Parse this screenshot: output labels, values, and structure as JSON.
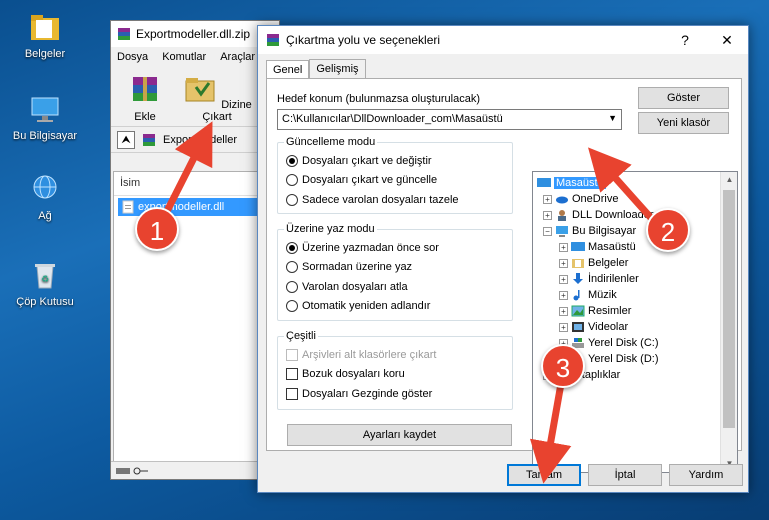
{
  "desktop": {
    "icons": [
      {
        "label": "Belgeler",
        "icon": "folder-icon"
      },
      {
        "label": "Bu Bilgisayar",
        "icon": "computer-icon"
      },
      {
        "label": "Ağ",
        "icon": "network-icon"
      },
      {
        "label": "Çöp Kutusu",
        "icon": "recycle-bin-icon"
      }
    ]
  },
  "winrar": {
    "title": "Exportmodeller.dll.zip",
    "menu": [
      "Dosya",
      "Komutlar",
      "Araçlar"
    ],
    "toolbar": [
      "Ekle",
      "Dizine Çıkart"
    ],
    "address": "Exportmodeller",
    "column_header": "İsim",
    "selected_file": "exportmodeller.dll"
  },
  "dialog": {
    "title": "Çıkartma yolu ve seçenekleri",
    "help": "?",
    "close": "✕",
    "tabs": [
      "Genel",
      "Gelişmiş"
    ],
    "dest_label": "Hedef konum (bulunmazsa oluşturulacak)",
    "dest_value": "C:\\Kullanıcılar\\DllDownloader_com\\Masaüstü",
    "show_button": "Göster",
    "new_folder_button": "Yeni klasör",
    "update_mode": {
      "title": "Güncelleme modu",
      "options": [
        "Dosyaları çıkart ve değiştir",
        "Dosyaları çıkart ve güncelle",
        "Sadece varolan dosyaları tazele"
      ],
      "selected": 0
    },
    "overwrite_mode": {
      "title": "Üzerine yaz modu",
      "options": [
        "Üzerine yazmadan önce sor",
        "Sormadan üzerine yaz",
        "Varolan dosyaları atla",
        "Otomatik yeniden adlandır"
      ],
      "selected": 0
    },
    "misc": {
      "title": "Çeşitli",
      "options": [
        "Arşivleri alt klasörlere çıkart",
        "Bozuk dosyaları koru",
        "Dosyaları Gezginde göster"
      ]
    },
    "save_settings": "Ayarları kaydet",
    "tree": [
      {
        "label": "Masaüstü",
        "level": 0,
        "icon": "desktop-icon",
        "selected": true
      },
      {
        "label": "OneDrive",
        "level": 1,
        "icon": "onedrive-icon"
      },
      {
        "label": "DLL Downloader.com",
        "level": 1,
        "icon": "user-icon"
      },
      {
        "label": "Bu Bilgisayar",
        "level": 1,
        "icon": "computer-icon",
        "expanded": true
      },
      {
        "label": "Masaüstü",
        "level": 2,
        "icon": "desktop-icon"
      },
      {
        "label": "Belgeler",
        "level": 2,
        "icon": "documents-icon"
      },
      {
        "label": "İndirilenler",
        "level": 2,
        "icon": "downloads-icon"
      },
      {
        "label": "Müzik",
        "level": 2,
        "icon": "music-icon"
      },
      {
        "label": "Resimler",
        "level": 2,
        "icon": "pictures-icon"
      },
      {
        "label": "Videolar",
        "level": 2,
        "icon": "videos-icon"
      },
      {
        "label": "Yerel Disk (C:)",
        "level": 2,
        "icon": "drive-icon"
      },
      {
        "label": "Yerel Disk (D:)",
        "level": 2,
        "icon": "drive-icon"
      },
      {
        "label": "Kitaplıklar",
        "level": 1,
        "icon": "libraries-icon"
      }
    ],
    "buttons": {
      "ok": "Tamam",
      "cancel": "İptal",
      "help": "Yardım"
    }
  },
  "callouts": [
    "1",
    "2",
    "3"
  ],
  "colors": {
    "arrow": "#e8432f",
    "selection": "#3399ff",
    "accent": "#0078d7"
  }
}
